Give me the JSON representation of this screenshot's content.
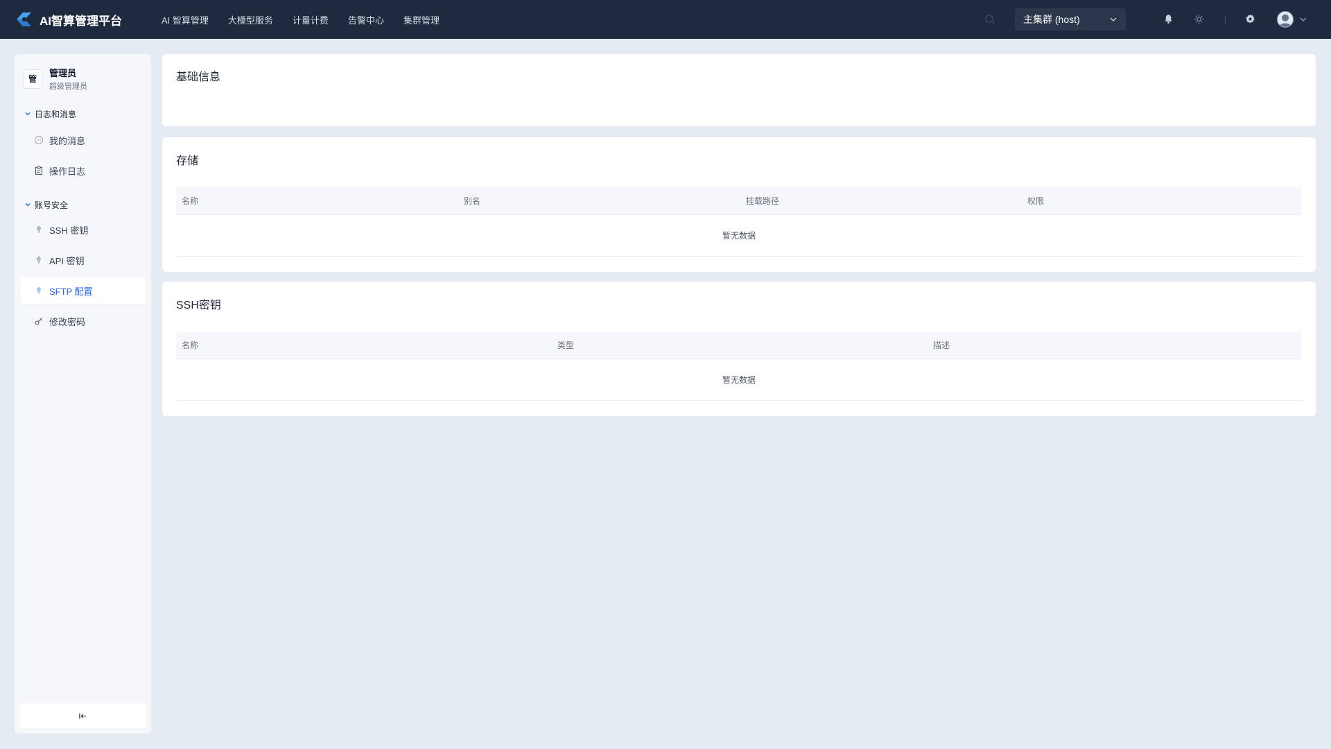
{
  "app": {
    "title": "AI智算管理平台"
  },
  "nav": {
    "items": [
      "AI 智算管理",
      "大模型服务",
      "计量计费",
      "告警中心",
      "集群管理"
    ]
  },
  "cluster": {
    "selected": "主集群 (host)"
  },
  "sidebar": {
    "user": {
      "badge": "管",
      "name": "管理员",
      "role": "超级管理员"
    },
    "groups": [
      {
        "title": "日志和消息",
        "items": [
          {
            "label": "我的消息",
            "icon": "message-icon"
          },
          {
            "label": "操作日志",
            "icon": "clipboard-icon"
          }
        ]
      },
      {
        "title": "账号安全",
        "items": [
          {
            "label": "SSH 密钥",
            "icon": "key-icon"
          },
          {
            "label": "API 密钥",
            "icon": "key-icon"
          },
          {
            "label": "SFTP 配置",
            "icon": "key-icon",
            "active": true
          },
          {
            "label": "修改密码",
            "icon": "password-icon"
          }
        ]
      }
    ],
    "collapse_glyph": "|←"
  },
  "main": {
    "basic": {
      "title": "基础信息"
    },
    "storage": {
      "title": "存储",
      "columns": [
        "名称",
        "别名",
        "挂载路径",
        "权限"
      ],
      "empty": "暂无数据"
    },
    "ssh": {
      "title": "SSH密钥",
      "columns": [
        "名称",
        "类型",
        "描述"
      ],
      "empty": "暂无数据"
    }
  },
  "colors": {
    "topbar": "#1e2a3e",
    "accent": "#2563eb",
    "page_bg": "#e5ebf2",
    "logo": "#4aa3f0"
  }
}
